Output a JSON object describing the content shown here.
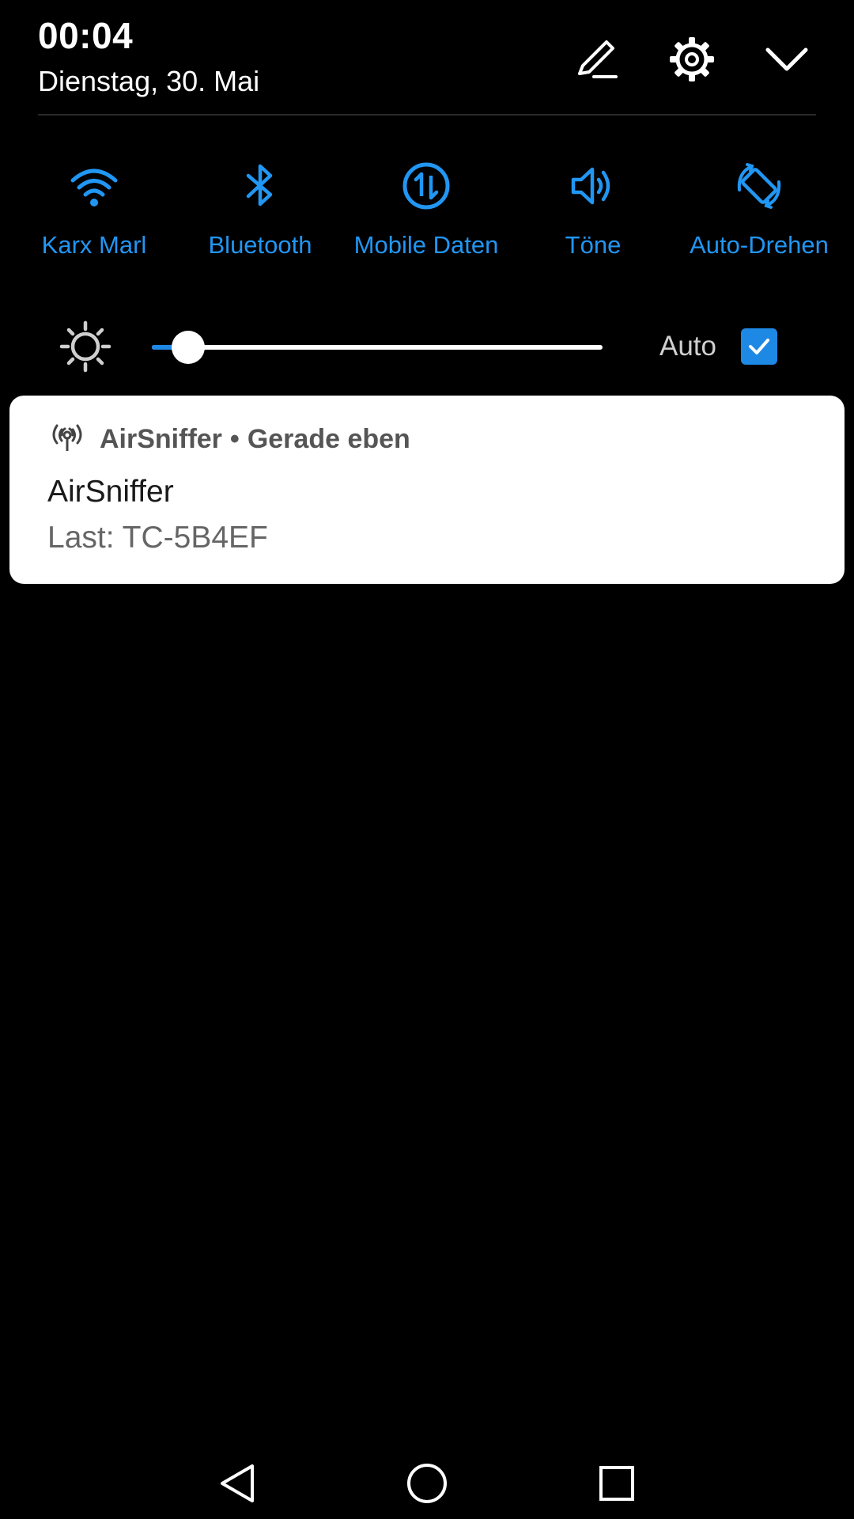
{
  "header": {
    "time": "00:04",
    "date": "Dienstag, 30. Mai",
    "icons": [
      "edit-icon",
      "gear-icon",
      "chevron-down-icon"
    ]
  },
  "quick_tiles": [
    {
      "label": "Karx Marl",
      "icon": "wifi-icon"
    },
    {
      "label": "Bluetooth",
      "icon": "bluetooth-icon"
    },
    {
      "label": "Mobile Daten",
      "icon": "mobile-data-icon"
    },
    {
      "label": "Töne",
      "icon": "sound-icon"
    },
    {
      "label": "Auto-Drehen",
      "icon": "auto-rotate-icon"
    }
  ],
  "brightness": {
    "level": 0.06,
    "auto_label": "Auto",
    "auto_checked": true
  },
  "notification": {
    "app_name": "AirSniffer",
    "separator": "•",
    "time": "Gerade eben",
    "title": "AirSniffer",
    "text": "Last: TC-5B4EF"
  },
  "navbar": {
    "icons": [
      "back-icon",
      "home-icon",
      "recents-icon"
    ]
  },
  "colors": {
    "accent": "#2196f3",
    "background": "#000000",
    "card": "#ffffff"
  }
}
